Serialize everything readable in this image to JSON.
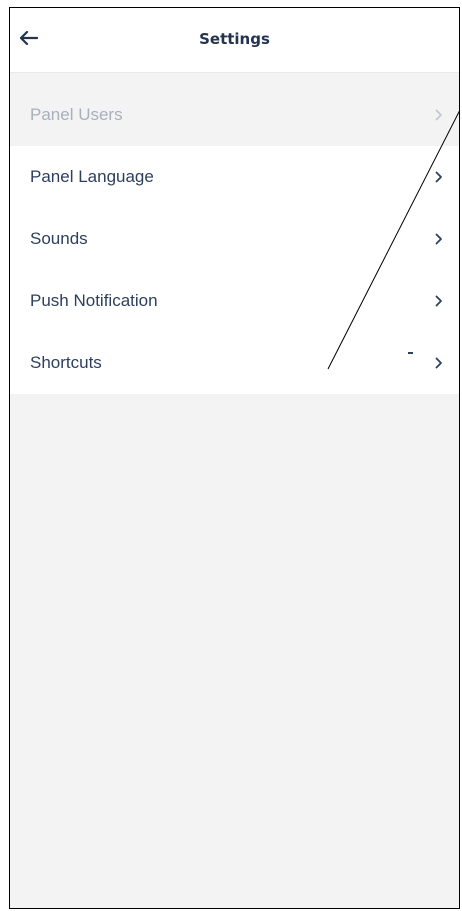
{
  "header": {
    "title": "Settings",
    "back_icon": "arrow-left-icon"
  },
  "settings": {
    "items": [
      {
        "label": "Panel Users",
        "enabled": false
      },
      {
        "label": "Panel Language",
        "enabled": true
      },
      {
        "label": "Sounds",
        "enabled": true
      },
      {
        "label": "Push Notification",
        "enabled": true
      },
      {
        "label": "Shortcuts",
        "enabled": true
      }
    ],
    "chevron_icon": "chevron-right-icon"
  },
  "colors": {
    "header_bg": "#ffffff",
    "page_bg": "#f3f3f3",
    "text": "#2d3f5c",
    "disabled_text": "#a8b0bd",
    "title": "#24344f"
  }
}
